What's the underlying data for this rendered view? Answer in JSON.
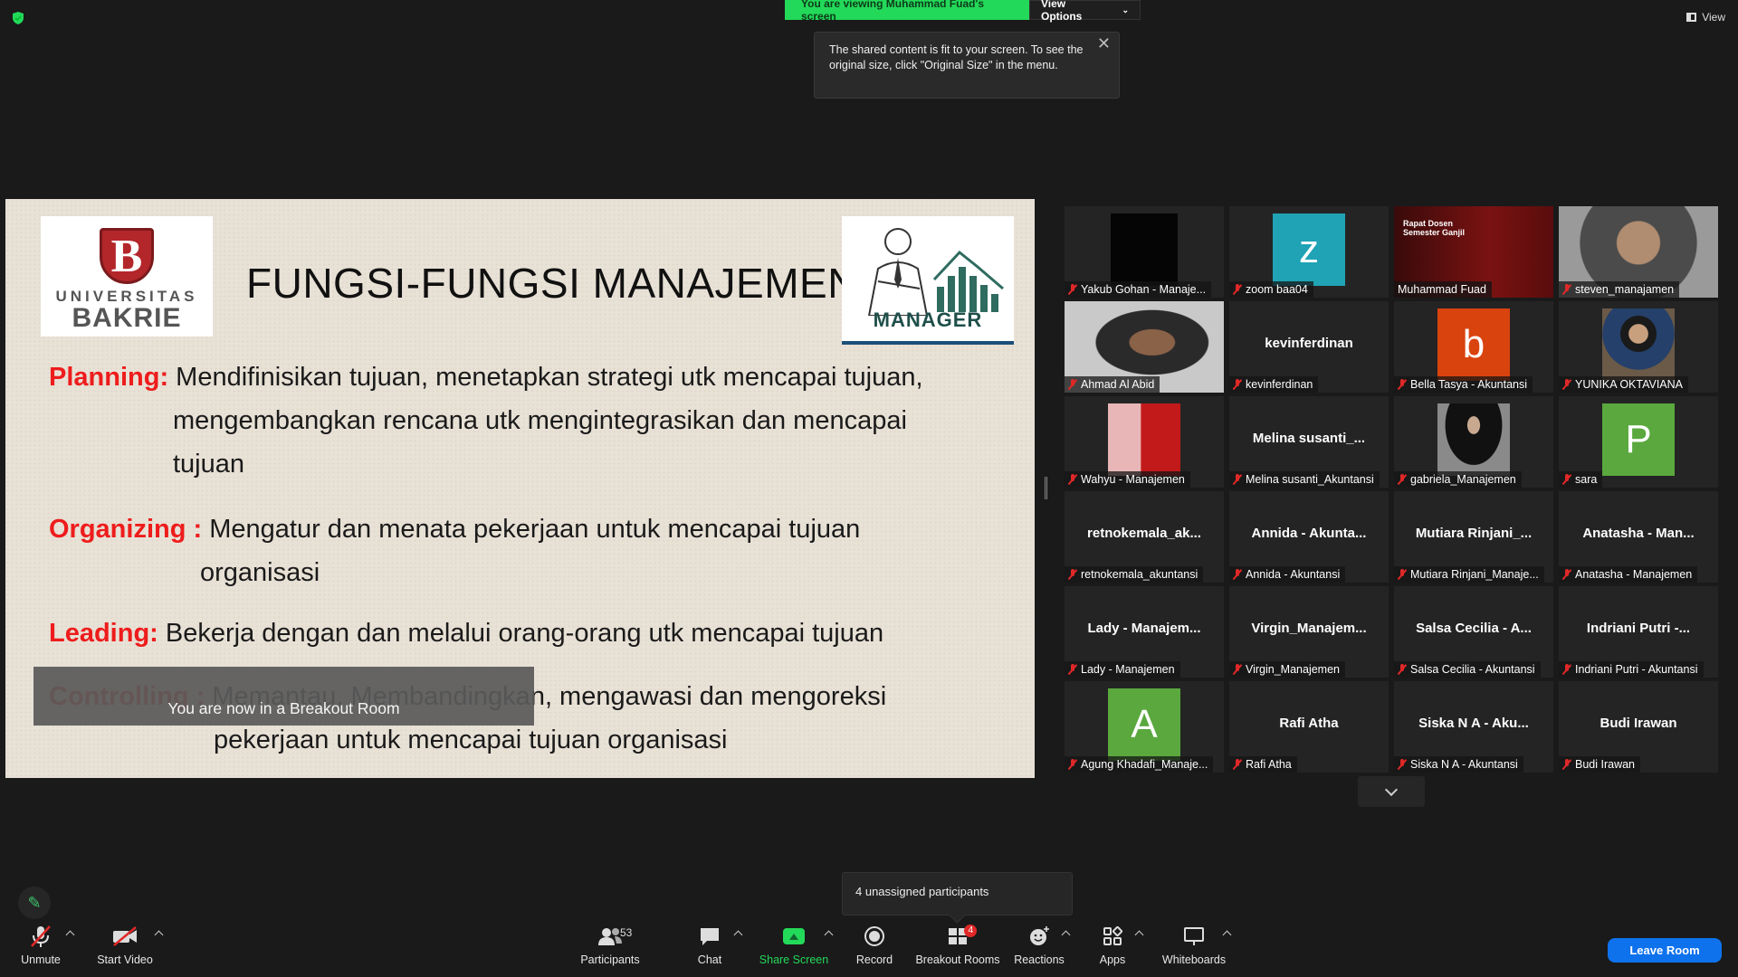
{
  "top": {
    "viewing_text": "You are viewing Muhammad Fuad's screen",
    "view_options_label": "View Options",
    "view_label": "View",
    "tooltip_text": "The shared content is fit to your screen. To see the original size, click \"Original Size\" in the menu."
  },
  "slide": {
    "title": "FUNGSI-FUNGSI MANAJEMEN",
    "logo_left_line1": "UNIVERSITAS",
    "logo_left_line2": "BAKRIE",
    "logo_right_text": "MANAGER",
    "terms": [
      {
        "key": "Planning:",
        "line1": " Mendifinisikan tujuan, menetapkan strategi utk mencapai tujuan,",
        "line2": "mengembangkan rencana utk mengintegrasikan dan mencapai",
        "line3": "tujuan"
      },
      {
        "key": "Organizing :",
        "line1": " Mengatur dan menata pekerjaan untuk mencapai tujuan",
        "line2": "organisasi"
      },
      {
        "key": "Leading:",
        "line1": " Bekerja dengan dan melalui orang-orang utk mencapai tujuan"
      },
      {
        "key": "Controlling :",
        "line1": " Memantau, Membandingkan, mengawasi dan mengoreksi",
        "line2": "pekerjaan untuk mencapai tujuan organisasi"
      }
    ],
    "breakout_toast": "You are now in a Breakout Room"
  },
  "gallery": [
    {
      "name": "Yakub Gohan - Manaje...",
      "center": "",
      "muted": true,
      "kind": "cam-dark"
    },
    {
      "name": "zoom baa04",
      "center": "",
      "muted": true,
      "kind": "avatar",
      "letter": "z",
      "color": "#1fa3b5"
    },
    {
      "name": "Muhammad Fuad",
      "center": "",
      "muted": false,
      "kind": "cam-red",
      "overlay": "Rapat Dosen Semester Ganjil"
    },
    {
      "name": "steven_manajamen",
      "center": "",
      "muted": true,
      "kind": "cam-face"
    },
    {
      "name": "Ahmad Al Abid",
      "center": "",
      "muted": true,
      "kind": "cam-man"
    },
    {
      "name": "kevinferdinan",
      "center": "kevinferdinan",
      "muted": true,
      "kind": "text"
    },
    {
      "name": "Bella Tasya - Akuntansi",
      "center": "",
      "muted": true,
      "kind": "avatar",
      "letter": "b",
      "color": "#d9430e"
    },
    {
      "name": "YUNIKA OKTAVIANA",
      "center": "",
      "muted": true,
      "kind": "photo-girl"
    },
    {
      "name": "Wahyu - Manajemen",
      "center": "",
      "muted": true,
      "kind": "photo-couple"
    },
    {
      "name": "Melina susanti_Akuntansi",
      "center": "Melina  susanti_...",
      "muted": true,
      "kind": "text"
    },
    {
      "name": "gabriela_Manajemen",
      "center": "",
      "muted": true,
      "kind": "photo-dark"
    },
    {
      "name": "sara",
      "center": "",
      "muted": true,
      "kind": "avatar",
      "letter": "P",
      "color": "#5aa83e"
    },
    {
      "name": "retnokemala_akuntansi",
      "center": "retnokemala_ak...",
      "muted": true,
      "kind": "text"
    },
    {
      "name": "Annida - Akuntansi",
      "center": "Annida  -  Akunta...",
      "muted": true,
      "kind": "text"
    },
    {
      "name": "Mutiara Rinjani_Manaje...",
      "center": "Mutiara  Rinjani_...",
      "muted": true,
      "kind": "text"
    },
    {
      "name": "Anatasha - Manajemen",
      "center": "Anatasha  -  Man...",
      "muted": true,
      "kind": "text"
    },
    {
      "name": "Lady - Manajemen",
      "center": "Lady  -  Manajem...",
      "muted": true,
      "kind": "text"
    },
    {
      "name": "Virgin_Manajemen",
      "center": "Virgin_Manajem...",
      "muted": true,
      "kind": "text"
    },
    {
      "name": "Salsa Cecilia - Akuntansi",
      "center": "Salsa  Cecilia  -  A...",
      "muted": true,
      "kind": "text"
    },
    {
      "name": "Indriani Putri - Akuntansi",
      "center": "Indriani  Putri  -...",
      "muted": true,
      "kind": "text"
    },
    {
      "name": "Agung Khadafi_Manaje...",
      "center": "",
      "muted": true,
      "kind": "avatar",
      "letter": "A",
      "color": "#5aa83e"
    },
    {
      "name": "Rafi Atha",
      "center": "Rafi Atha",
      "muted": true,
      "kind": "text"
    },
    {
      "name": "Siska N A - Akuntansi",
      "center": "Siska  N  A  -  Aku...",
      "muted": true,
      "kind": "text"
    },
    {
      "name": "Budi Irawan",
      "center": "Budi Irawan",
      "muted": true,
      "kind": "text"
    }
  ],
  "unassigned_text": "4 unassigned participants",
  "toolbar": {
    "unmute": "Unmute",
    "start_video": "Start Video",
    "participants": "Participants",
    "participants_count": "53",
    "chat": "Chat",
    "share_screen": "Share Screen",
    "record": "Record",
    "breakout_rooms": "Breakout Rooms",
    "breakout_badge": "4",
    "reactions": "Reactions",
    "apps": "Apps",
    "whiteboards": "Whiteboards",
    "leave_room": "Leave Room"
  },
  "colors": {
    "accent_green": "#23d959",
    "leave_blue": "#0e72ed",
    "muted_red": "#e02828",
    "slide_keyword": "#ee1c1c"
  }
}
